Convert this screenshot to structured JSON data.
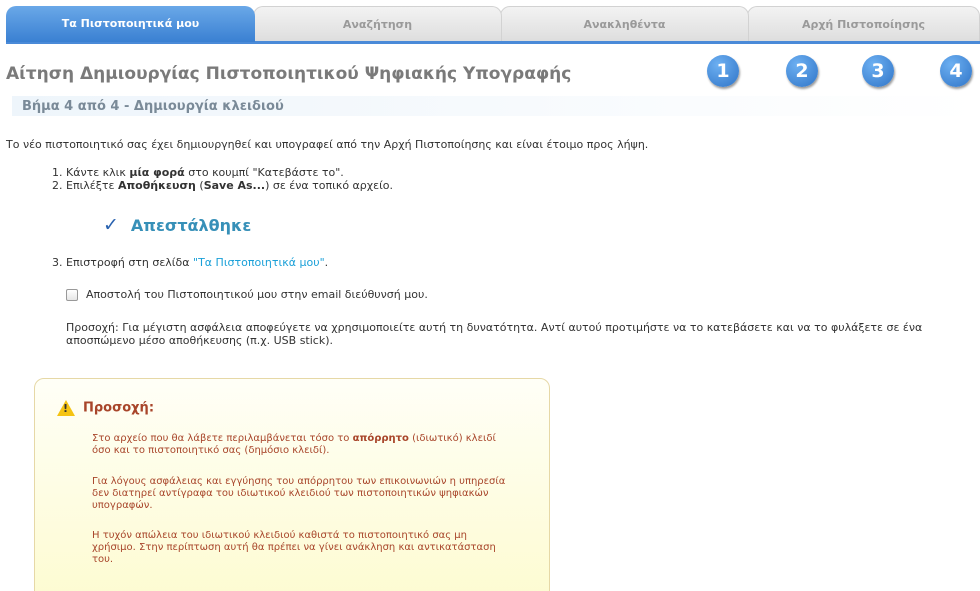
{
  "tabs": [
    {
      "label": "Τα Πιστοποιητικά μου",
      "active": true
    },
    {
      "label": "Αναζήτηση",
      "active": false
    },
    {
      "label": "Ανακληθέντα",
      "active": false
    },
    {
      "label": "Αρχή Πιστοποίησης",
      "active": false
    }
  ],
  "page_title": "Αίτηση Δημιουργίας Πιστοποιητικού Ψηφιακής Υπογραφής",
  "steps_indicator": [
    "1",
    "2",
    "3",
    "4"
  ],
  "step_header": "Βήμα 4 από 4 - Δημιουργία κλειδιού",
  "intro": "Το νέο πιστοποιητικό σας έχει δημιουργηθεί και υπογραφεί από την Αρχή Πιστοποίησης και είναι έτοιμο προς λήψη.",
  "instructions": {
    "step1_prefix": "1. Κάντε κλικ ",
    "step1_bold": "μία φορά",
    "step1_suffix": " στο κουμπί \"Κατεβάστε το\".",
    "step2_prefix": "2. Επιλέξτε ",
    "step2_bold1": "Αποθήκευση",
    "step2_mid": " (",
    "step2_bold2": "Save As...",
    "step2_suffix": ") σε ένα τοπικό αρχείο."
  },
  "sent": {
    "icon": "checkmark-icon",
    "label": "Απεστάλθηκε"
  },
  "return_line": {
    "prefix": "3. Επιστροφή στη σελίδα ",
    "link": "\"Τα Πιστοποιητικά μου\"",
    "suffix": "."
  },
  "email_option": {
    "label": "Αποστολή του Πιστοποιητικού μου στην email διεύθυνσή μου.",
    "checked": false
  },
  "caution_text": "Προσοχή: Για μέγιστη ασφάλεια αποφεύγετε να χρησιμοποιείτε αυτή τη δυνατότητα. Αντί αυτού προτιμήστε να το κατεβάσετε και να το φυλάξετε σε ένα αποσπώμενο μέσο αποθήκευσης (π.χ. USB stick).",
  "warning": {
    "icon": "warning-triangle-icon",
    "title": "Προσοχή:",
    "p1_prefix": "Στο αρχείο που θα λάβετε περιλαμβάνεται τόσο το ",
    "p1_bold": "απόρρητο",
    "p1_suffix": " (ιδιωτικό) κλειδί όσο και το πιστοποιητικό σας (δημόσιο κλειδί).",
    "p2": "Για λόγους ασφάλειας και εγγύησης του απόρρητου των επικοινωνιών η υπηρεσία δεν διατηρεί αντίγραφα του ιδιωτικού κλειδιού των πιστοποιητικών ψηφιακών υπογραφών.",
    "p3": "Η τυχόν απώλεια του ιδιωτικού κλειδιού καθιστά το πιστοποιητικό σας μη χρήσιμο. Στην περίπτωση αυτή θα πρέπει να γίνει ανάκληση και αντικατάσταση του."
  },
  "colors": {
    "accent": "#3a80d2",
    "link": "#1aa0d8",
    "sent": "#3790b8",
    "warning_text": "#a8452a",
    "warning_icon": "#f5c312"
  }
}
